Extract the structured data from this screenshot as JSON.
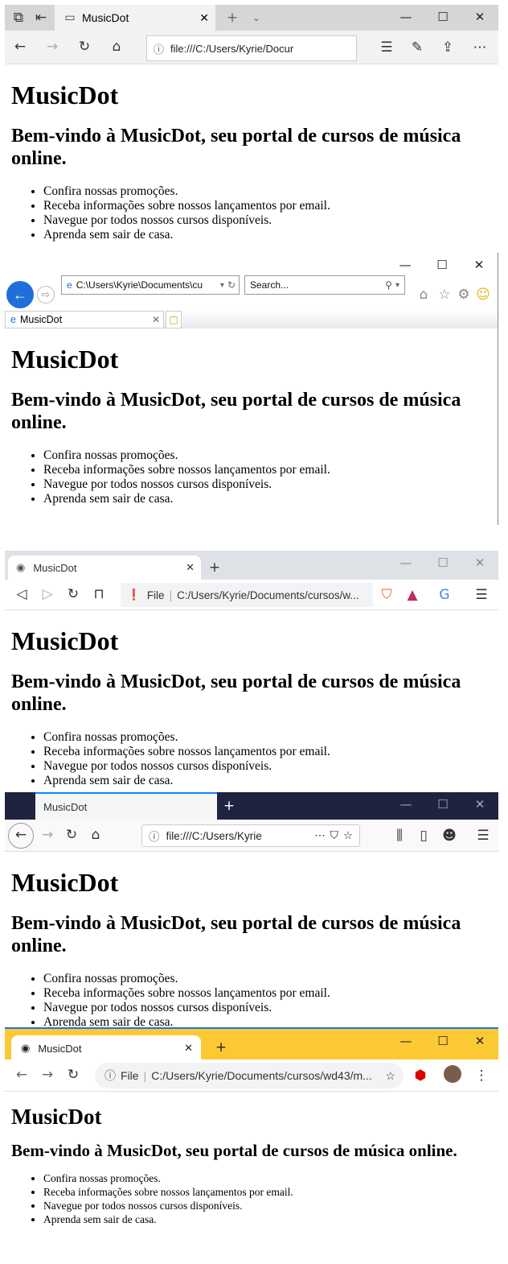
{
  "page": {
    "title": "MusicDot",
    "heading": "MusicDot",
    "subheading": "Bem-vindo à MusicDot, seu portal de cursos de música online.",
    "items": [
      "Confira nossas promoções.",
      "Receba informações sobre nossos lançamentos por email.",
      "Navegue por todos nossos cursos disponíveis.",
      "Aprenda sem sair de casa."
    ]
  },
  "edge": {
    "tab_title": "MusicDot",
    "address": "file:///C:/Users/Kyrie/Docur"
  },
  "ie": {
    "address": "C:\\Users\\Kyrie\\Documents\\cu",
    "search_placeholder": "Search...",
    "tab_title": "MusicDot"
  },
  "brave": {
    "tab_title": "MusicDot",
    "file_label": "File",
    "address": "C:/Users/Kyrie/Documents/cursos/w..."
  },
  "firefox": {
    "tab_title": "MusicDot",
    "address": "file:///C:/Users/Kyrie"
  },
  "chrome": {
    "tab_title": "MusicDot",
    "file_label": "File",
    "address": "C:/Users/Kyrie/Documents/cursos/wd43/m..."
  },
  "colors": {
    "ie_back": "#1e6fd9",
    "firefox_titlebar": "#202340",
    "chrome_titlebar": "#fcc934"
  }
}
